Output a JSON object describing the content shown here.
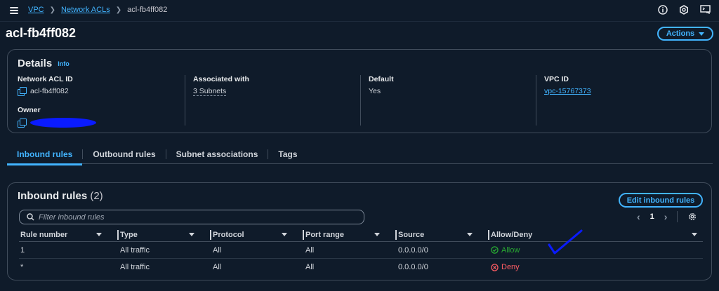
{
  "breadcrumb": {
    "items": [
      "VPC",
      "Network ACLs"
    ],
    "current": "acl-fb4ff082"
  },
  "icons": {
    "menu": "hamburger-menu-icon",
    "info": "info-circle-icon",
    "settings": "settings-gear-icon",
    "cloudshell": "cloudshell-icon"
  },
  "page": {
    "title": "acl-fb4ff082",
    "actions_label": "Actions"
  },
  "details": {
    "title": "Details",
    "info_label": "Info",
    "network_acl_id": {
      "label": "Network ACL ID",
      "value": "acl-fb4ff082"
    },
    "associated_with": {
      "label": "Associated with",
      "value": "3 Subnets"
    },
    "default": {
      "label": "Default",
      "value": "Yes"
    },
    "vpc_id": {
      "label": "VPC ID",
      "value": "vpc-15767373"
    },
    "owner": {
      "label": "Owner"
    }
  },
  "tabs": [
    {
      "label": "Inbound rules",
      "active": true
    },
    {
      "label": "Outbound rules"
    },
    {
      "label": "Subnet associations"
    },
    {
      "label": "Tags"
    }
  ],
  "inbound": {
    "title": "Inbound rules",
    "count": "(2)",
    "edit_label": "Edit inbound rules",
    "filter_placeholder": "Filter inbound rules",
    "page": "1",
    "columns": [
      "Rule number",
      "Type",
      "Protocol",
      "Port range",
      "Source",
      "Allow/Deny"
    ],
    "rows": [
      {
        "rule": "1",
        "type": "All traffic",
        "protocol": "All",
        "port": "All",
        "source": "0.0.0.0/0",
        "action": "Allow"
      },
      {
        "rule": "*",
        "type": "All traffic",
        "protocol": "All",
        "port": "All",
        "source": "0.0.0.0/0",
        "action": "Deny"
      }
    ]
  },
  "colors": {
    "accent": "#42b4ff",
    "allow": "#29ad32",
    "deny": "#ff5d64",
    "annotation": "#0a1bff"
  }
}
